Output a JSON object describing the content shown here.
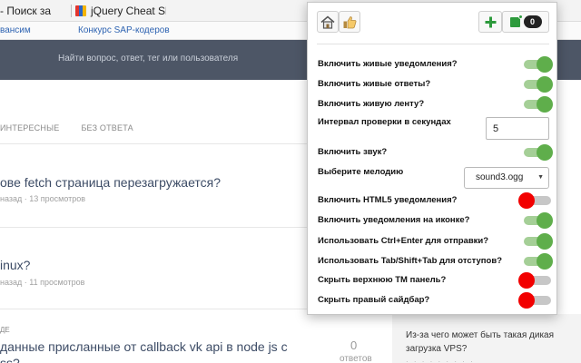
{
  "browser": {
    "tabs": [
      {
        "label": "- Поиск за"
      },
      {
        "label": "jQuery Cheat She"
      }
    ],
    "bookmarks": [
      "вансим",
      "Конкурс SAP-кодеров"
    ]
  },
  "site": {
    "search_placeholder": "Найти вопрос, ответ, тег или пользователя",
    "filters": [
      "ИНТЕРЕСНЫЕ",
      "БЕЗ ОТВЕТА"
    ],
    "questions": [
      {
        "title": "ове fetch страница перезагружается?",
        "meta": "назад · 13 просмотров"
      },
      {
        "title": "inux?",
        "meta": "назад · 11 просмотров"
      },
      {
        "tag": "ДЕ",
        "title": "данные присланные от callback vk api в node js с",
        "title2": "ss?",
        "answers": "0",
        "answers_label": "ответов"
      }
    ],
    "sidebar_text": "Из-за чего может быть такая дикая загрузка VPS?"
  },
  "popup": {
    "toolbar": {
      "badge_count": "0"
    },
    "settings": [
      {
        "label": "Включить живые уведомления?",
        "state": "on"
      },
      {
        "label": "Включить живые ответы?",
        "state": "on"
      },
      {
        "label": "Включить живую ленту?",
        "state": "on"
      },
      {
        "label": "Интервал проверки в секундах",
        "input_value": "5"
      },
      {
        "label": "Включить звук?",
        "state": "on"
      },
      {
        "label": "Выберите мелодию",
        "select_value": "sound3.ogg"
      },
      {
        "label": "Включить HTML5 уведомления?",
        "state": "off"
      },
      {
        "label": "Включить уведомления на иконке?",
        "state": "on"
      },
      {
        "label": "Использовать Ctrl+Enter для отправки?",
        "state": "on"
      },
      {
        "label": "Использовать Tab/Shift+Tab для отступов?",
        "state": "on"
      },
      {
        "label": "Скрыть верхнюю ТМ панель?",
        "state": "off"
      },
      {
        "label": "Скрыть правый сайдбар?",
        "state": "off"
      }
    ]
  }
}
